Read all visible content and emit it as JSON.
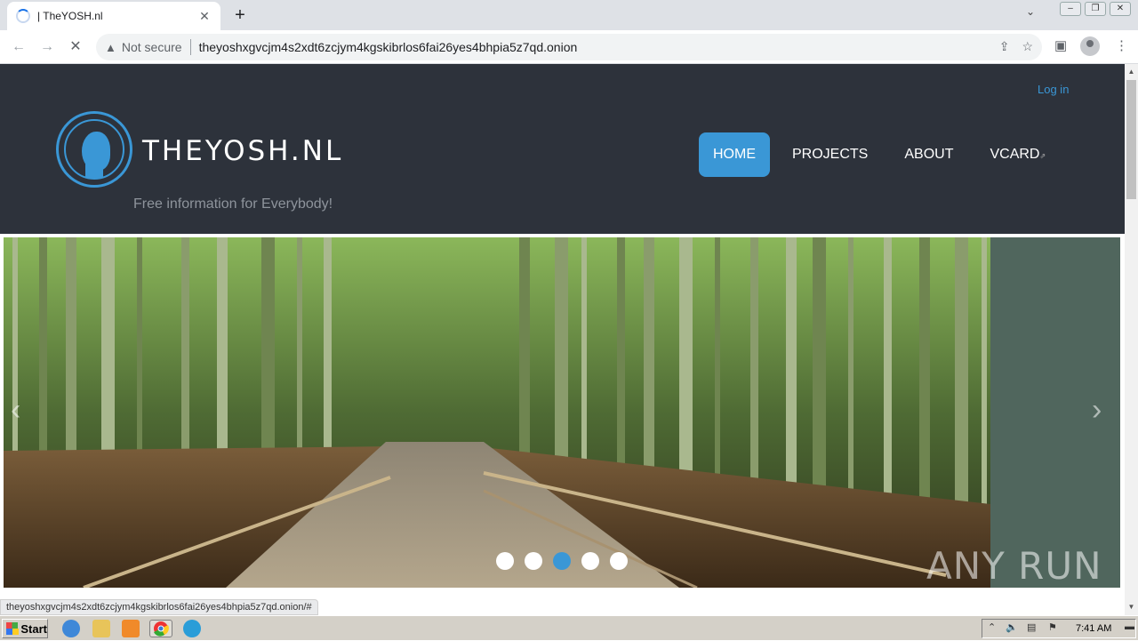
{
  "browser": {
    "tab_title": "| TheYOSH.nl",
    "not_secure": "Not secure",
    "url": "theyoshxgvcjm4s2xdt6zcjym4kgskibrlos6fai26yes4bhpia5z7qd.onion"
  },
  "site": {
    "login_link": "Log in",
    "brand": "THEYOSH.NL",
    "tagline": "Free information for Everybody!",
    "nav": [
      {
        "label": "HOME",
        "active": true
      },
      {
        "label": "PROJECTS",
        "active": false
      },
      {
        "label": "ABOUT",
        "active": false
      },
      {
        "label": "VCARD",
        "active": false
      }
    ],
    "slider": {
      "prev_arrow": "‹",
      "next_arrow": "›",
      "active_slide": 3,
      "slide_count": 5
    }
  },
  "status_url": "theyoshxgvcjm4s2xdt6zcjym4kgskibrlos6fai26yes4bhpia5z7qd.onion/#",
  "watermark": "ANY RUN",
  "taskbar": {
    "start_label": "Start",
    "clock": "7:41 AM"
  },
  "colors": {
    "header_bg": "#2d323b",
    "accent": "#3a97d6"
  }
}
